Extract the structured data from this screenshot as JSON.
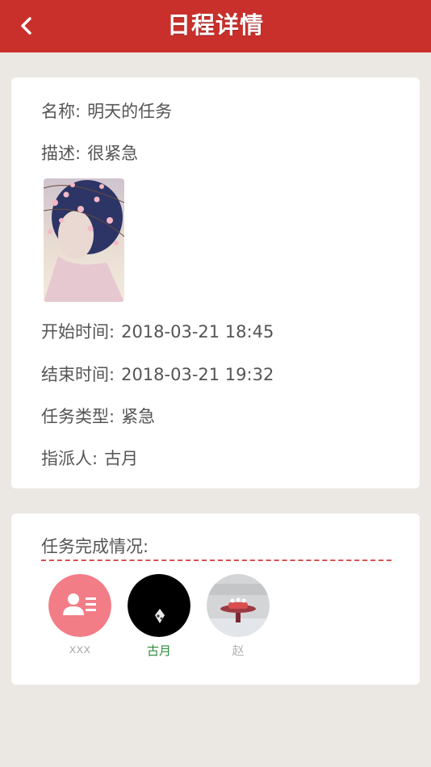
{
  "header": {
    "title": "日程详情",
    "back_icon": "chevron-left-icon"
  },
  "details": {
    "name_label": "名称:",
    "name_value": "明天的任务",
    "desc_label": "描述:",
    "desc_value": "很紧急",
    "start_label": "开始时间:",
    "start_value": "2018-03-21 18:45",
    "end_label": "结束时间:",
    "end_value": "2018-03-21 19:32",
    "type_label": "任务类型:",
    "type_value": "紧急",
    "assigner_label": "指派人:",
    "assigner_value": "古月"
  },
  "completion": {
    "title": "任务完成情况:",
    "people": [
      {
        "name": "xxx",
        "color": "#b3b3b3",
        "avatar": "contact-card-icon"
      },
      {
        "name": "古月",
        "color": "#2e8b3a",
        "avatar": "dark-photo"
      },
      {
        "name": "赵",
        "color": "#b3b3b3",
        "avatar": "cake-photo"
      }
    ]
  },
  "colors": {
    "header_bg": "#c9302c",
    "page_bg": "#ebe7e3",
    "dash_line": "#d9534f",
    "contact_avatar_bg": "#f27d86"
  }
}
